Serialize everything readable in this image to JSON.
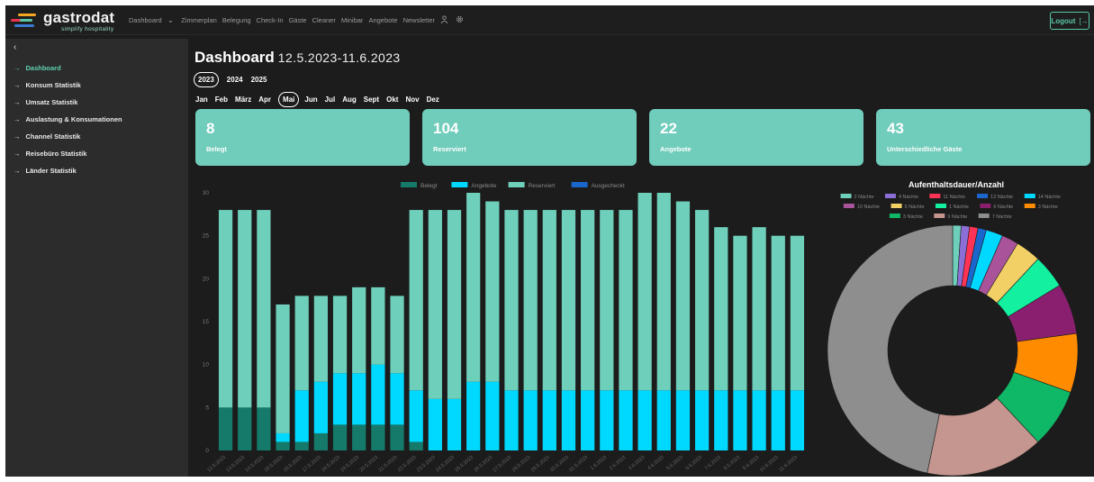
{
  "app": {
    "name": "gastrodat",
    "tagline": "simplify hospitality"
  },
  "nav": {
    "items": [
      "Dashboard",
      "Zimmerplan",
      "Belegung",
      "Check-In",
      "Gäste",
      "Cleaner",
      "Minibar",
      "Angebote",
      "Newsletter"
    ],
    "dropdown_icon": "chevron-down-icon",
    "user_icon": "user-icon",
    "settings_icon": "gear-icon"
  },
  "logout": {
    "label": "Logout"
  },
  "sidebar": {
    "collapse_icon": "chevron-left-icon",
    "items": [
      {
        "label": "Dashboard",
        "active": true
      },
      {
        "label": "Konsum Statistik"
      },
      {
        "label": "Umsatz Statistik"
      },
      {
        "label": "Auslastung & Konsumationen"
      },
      {
        "label": "Channel Statistik"
      },
      {
        "label": "Reisebüro Statistik"
      },
      {
        "label": "Länder Statistik"
      }
    ]
  },
  "page": {
    "title": "Dashboard",
    "range": "12.5.2023-11.6.2023"
  },
  "years": {
    "items": [
      "2023",
      "2024",
      "2025"
    ],
    "selected": "2023"
  },
  "months": {
    "items": [
      "Jan",
      "Feb",
      "März",
      "Apr",
      "Mai",
      "Jun",
      "Jul",
      "Aug",
      "Sept",
      "Okt",
      "Nov",
      "Dez"
    ],
    "selected": "Mai"
  },
  "cards": [
    {
      "value": "8",
      "label": "Belegt"
    },
    {
      "value": "104",
      "label": "Reserviert"
    },
    {
      "value": "22",
      "label": "Angebote"
    },
    {
      "value": "43",
      "label": "Unterschiedliche Gäste"
    }
  ],
  "colors": {
    "accent": "#70ccbb",
    "belegt": "#157a6a",
    "angebote": "#00d9ff",
    "reserviert": "#6ecfba",
    "ausgecheckt": "#1a66cc"
  },
  "chart_data": [
    {
      "type": "bar",
      "stacked": true,
      "title": "",
      "ylim": [
        0,
        30
      ],
      "yticks": [
        0,
        5,
        10,
        15,
        20,
        25,
        30
      ],
      "grid": false,
      "legend_position": "top",
      "categories": [
        "12.5.2023",
        "13.5.2023",
        "14.5.2023",
        "15.5.2023",
        "16.5.2023",
        "17.5.2023",
        "18.5.2023",
        "19.5.2023",
        "20.5.2023",
        "21.5.2023",
        "22.5.2023",
        "23.5.2023",
        "24.5.2023",
        "25.5.2023",
        "26.5.2023",
        "27.5.2023",
        "28.5.2023",
        "29.5.2023",
        "30.5.2023",
        "31.5.2023",
        "1.6.2023",
        "2.6.2023",
        "3.6.2023",
        "4.6.2023",
        "5.6.2023",
        "6.6.2023",
        "7.6.2023",
        "8.6.2023",
        "9.6.2023",
        "10.6.2023",
        "11.6.2023"
      ],
      "series": [
        {
          "name": "Belegt",
          "color": "#157a6a",
          "values": [
            5,
            5,
            5,
            1,
            1,
            2,
            3,
            3,
            3,
            3,
            1,
            0,
            0,
            0,
            0,
            0,
            0,
            0,
            0,
            0,
            0,
            0,
            0,
            0,
            0,
            0,
            0,
            0,
            0,
            0,
            0
          ]
        },
        {
          "name": "Angebote",
          "color": "#00d9ff",
          "values": [
            0,
            0,
            0,
            1,
            6,
            6,
            6,
            6,
            7,
            6,
            6,
            6,
            6,
            8,
            8,
            7,
            7,
            7,
            7,
            7,
            7,
            7,
            7,
            7,
            7,
            7,
            7,
            7,
            7,
            7,
            7
          ]
        },
        {
          "name": "Reserviert",
          "color": "#6ecfba",
          "values": [
            23,
            23,
            23,
            15,
            11,
            10,
            9,
            10,
            9,
            9,
            21,
            22,
            22,
            22,
            21,
            21,
            21,
            21,
            21,
            21,
            21,
            21,
            23,
            23,
            22,
            21,
            19,
            18,
            19,
            18,
            18
          ]
        },
        {
          "name": "Ausgecheckt",
          "color": "#1a66cc",
          "values": [
            0,
            0,
            0,
            0,
            0,
            0,
            0,
            0,
            0,
            0,
            0,
            0,
            0,
            0,
            0,
            0,
            0,
            0,
            0,
            0,
            0,
            0,
            0,
            0,
            0,
            0,
            0,
            0,
            0,
            0,
            0
          ]
        }
      ]
    },
    {
      "type": "pie",
      "donut": true,
      "title": "Aufenthaltsdauer/Anzahl",
      "legend_position": "top",
      "slices": [
        {
          "label": "2 Nächte",
          "color": "#6ecfba",
          "value": 1
        },
        {
          "label": "4 Nächte",
          "color": "#8c6fd6",
          "value": 1
        },
        {
          "label": "11 Nächte",
          "color": "#ff3355",
          "value": 1
        },
        {
          "label": "13 Nächte",
          "color": "#1a66cc",
          "value": 1
        },
        {
          "label": "14 Nächte",
          "color": "#00d9ff",
          "value": 2
        },
        {
          "label": "10 Nächte",
          "color": "#a9549a",
          "value": 2
        },
        {
          "label": "5 Nächte",
          "color": "#f2d066",
          "value": 3
        },
        {
          "label": "1 Nächte",
          "color": "#12f0a0",
          "value": 4
        },
        {
          "label": "6 Nächte",
          "color": "#8b1f6f",
          "value": 6
        },
        {
          "label": "3 Nächte",
          "color": "#ff8c00",
          "value": 7
        },
        {
          "label": "3 Nächte",
          "color": "#0fb866",
          "value": 7
        },
        {
          "label": "9 Nächte",
          "color": "#c4968f",
          "value": 14
        },
        {
          "label": "7 Nächte",
          "color": "#8e8e8e",
          "value": 43
        }
      ]
    }
  ]
}
